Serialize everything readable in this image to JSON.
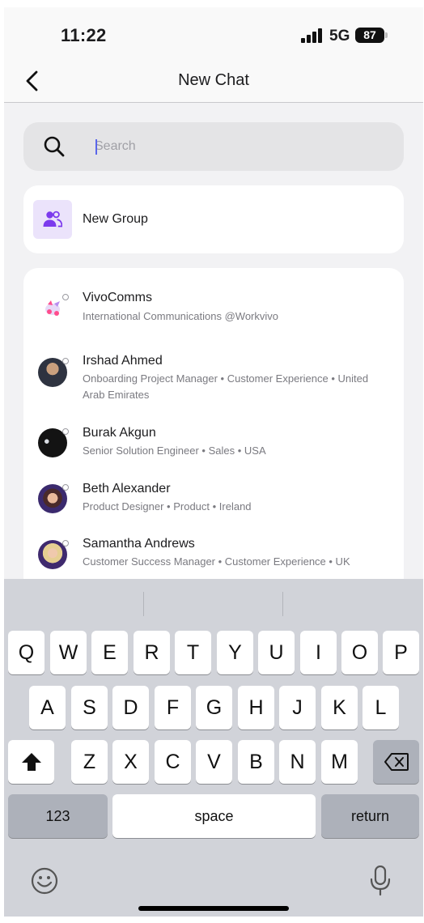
{
  "status_bar": {
    "time": "11:22",
    "network": "5G",
    "battery": "87"
  },
  "nav": {
    "title": "New Chat"
  },
  "search": {
    "placeholder": "Search"
  },
  "new_group": {
    "label": "New Group",
    "icon": "people-icon",
    "icon_color": "#7c3aed"
  },
  "contacts": [
    {
      "name": "VivoComms",
      "subtitle": "International Communications @Workvivo"
    },
    {
      "name": "Irshad Ahmed",
      "subtitle": "Onboarding Project Manager • Customer Experience • United Arab Emirates"
    },
    {
      "name": "Burak Akgun",
      "subtitle": "Senior Solution Engineer • Sales • USA"
    },
    {
      "name": "Beth Alexander",
      "subtitle": "Product Designer • Product • Ireland"
    },
    {
      "name": "Samantha Andrews",
      "subtitle": "Customer Success Manager • Customer Experience • UK"
    }
  ],
  "keyboard": {
    "row1": [
      "Q",
      "W",
      "E",
      "R",
      "T",
      "Y",
      "U",
      "I",
      "O",
      "P"
    ],
    "row2": [
      "A",
      "S",
      "D",
      "F",
      "G",
      "H",
      "J",
      "K",
      "L"
    ],
    "row3": [
      "Z",
      "X",
      "C",
      "V",
      "B",
      "N",
      "M"
    ],
    "numbers_label": "123",
    "space_label": "space",
    "return_label": "return"
  }
}
